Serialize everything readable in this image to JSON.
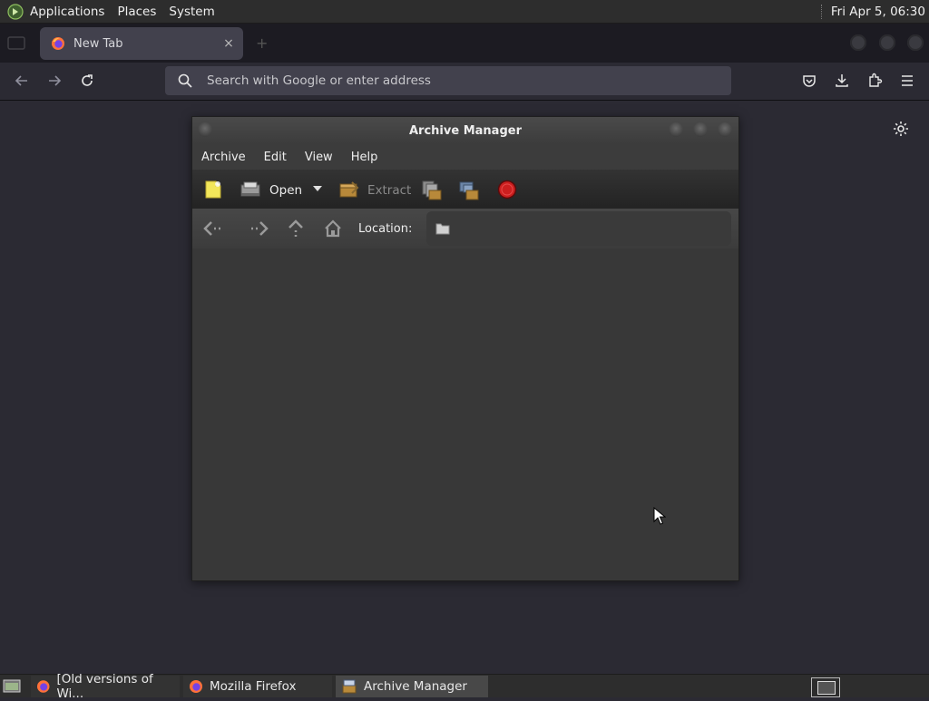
{
  "panel": {
    "menus": [
      "Applications",
      "Places",
      "System"
    ],
    "clock": "Fri Apr  5, 06:30"
  },
  "browser": {
    "tab_title": "New Tab",
    "tab_close": "×",
    "search_placeholder": "Search with Google or enter address"
  },
  "archive_manager": {
    "title": "Archive Manager",
    "menu": [
      "Archive",
      "Edit",
      "View",
      "Help"
    ],
    "toolbar": {
      "open_label": "Open",
      "extract_label": "Extract"
    },
    "location_label": "Location:"
  },
  "taskbar": {
    "items": [
      "[Old versions of Wi...",
      "Mozilla Firefox",
      "Archive Manager"
    ]
  },
  "colors": {
    "panel_bg": "#2d2d2d",
    "firefox_toolbar": "#2b2a33",
    "stop_red": "#cc1f1f",
    "new_icon_yellow": "#f2e65a"
  }
}
